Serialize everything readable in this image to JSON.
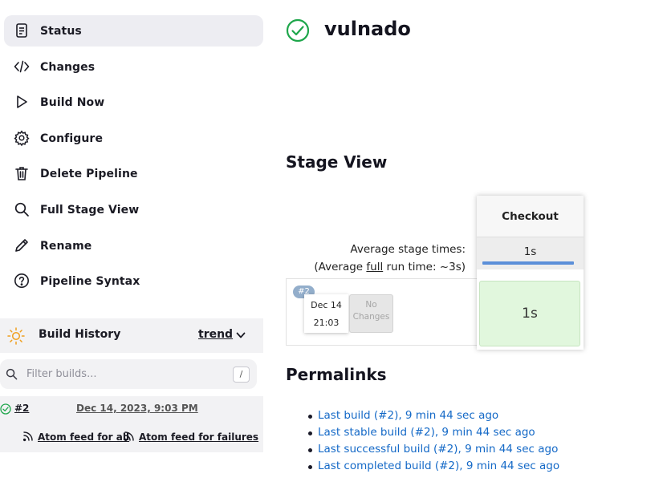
{
  "sidebar": {
    "tasks": [
      {
        "label": "Status",
        "icon": "document-icon"
      },
      {
        "label": "Changes",
        "icon": "code-icon"
      },
      {
        "label": "Build Now",
        "icon": "play-icon"
      },
      {
        "label": "Configure",
        "icon": "gear-icon"
      },
      {
        "label": "Delete Pipeline",
        "icon": "trash-icon"
      },
      {
        "label": "Full Stage View",
        "icon": "search-icon"
      },
      {
        "label": "Rename",
        "icon": "pencil-icon"
      },
      {
        "label": "Pipeline Syntax",
        "icon": "help-icon"
      }
    ],
    "build_history": {
      "title": "Build History",
      "trend_label": "trend",
      "filter_placeholder": "Filter builds...",
      "shortcut_key": "/",
      "builds": [
        {
          "number": "#2",
          "date": "Dec 14, 2023, 9:03 PM",
          "status": "success"
        }
      ],
      "feeds": {
        "all": "Atom feed for all",
        "failures": "Atom feed for failures"
      }
    }
  },
  "main": {
    "job_title": "vulnado",
    "stage_view": {
      "heading": "Stage View",
      "avg_stage_times": "Average stage times:",
      "avg_full_prefix": "(Average ",
      "avg_full_link": "full",
      "avg_full_suffix": " run time: ~3s)",
      "stage_name": "Checkout",
      "stage_avg": "1s",
      "run": {
        "badge": "#2",
        "date": "Dec 14",
        "time": "21:03",
        "no_changes_line1": "No",
        "no_changes_line2": "Changes",
        "stage_duration": "1s"
      }
    },
    "permalinks": {
      "heading": "Permalinks",
      "links": [
        "Last build (#2), 9 min 44 sec ago",
        "Last stable build (#2), 9 min 44 sec ago",
        "Last successful build (#2), 9 min 44 sec ago",
        "Last completed build (#2), 9 min 44 sec ago"
      ]
    }
  },
  "colors": {
    "success": "#1ea64b",
    "link": "#1469c7",
    "stage_success_bg": "#e1f7dd",
    "progress_bar": "#5b8fd9"
  }
}
